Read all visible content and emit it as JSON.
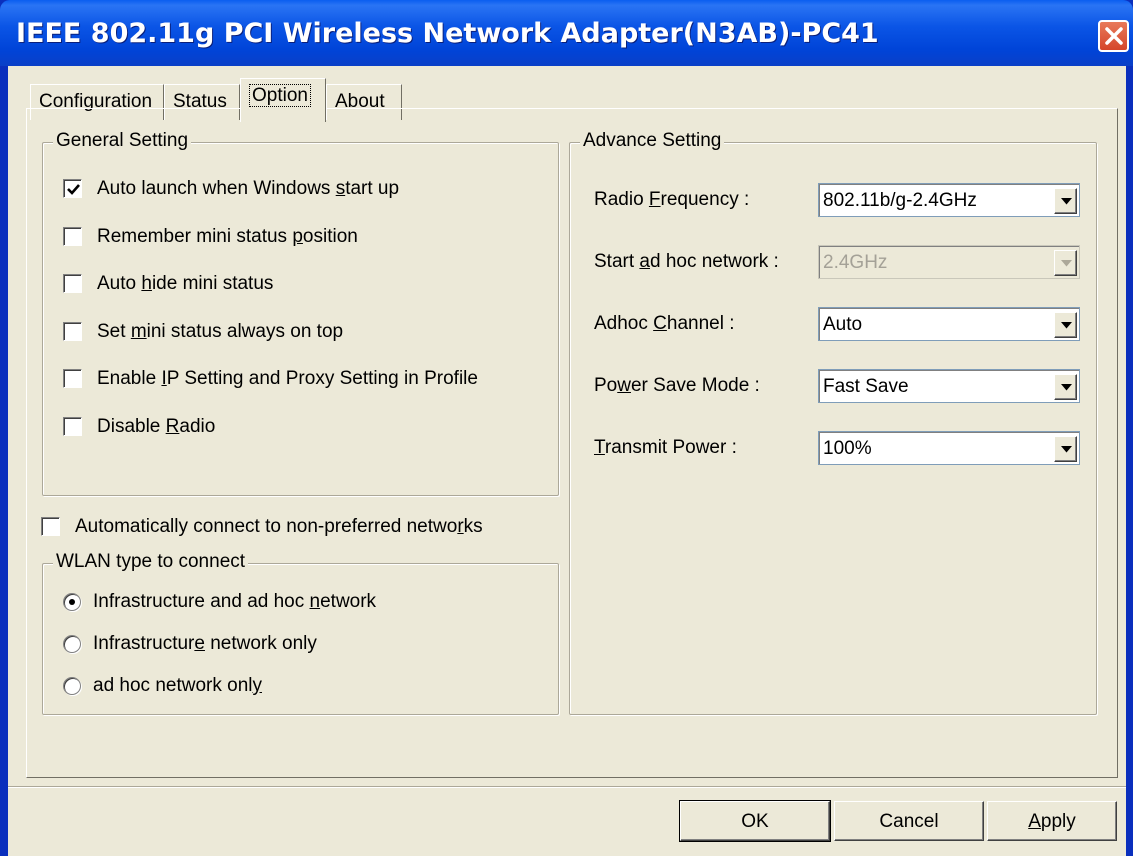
{
  "window": {
    "title": "IEEE 802.11g PCI Wireless Network Adapter(N3AB)-PC41"
  },
  "tabs": [
    {
      "label": "Configuration",
      "active": false
    },
    {
      "label": "Status",
      "active": false
    },
    {
      "label": "Option",
      "active": true
    },
    {
      "label": "About",
      "active": false
    }
  ],
  "general_setting": {
    "title": "General Setting",
    "items": [
      {
        "pre": "Auto launch when Windows ",
        "accel": "s",
        "post": "tart up",
        "checked": true
      },
      {
        "pre": "Remember mini status ",
        "accel": "p",
        "post": "osition",
        "checked": false
      },
      {
        "pre": "Auto ",
        "accel": "h",
        "post": "ide mini status",
        "checked": false
      },
      {
        "pre": "Set ",
        "accel": "m",
        "post": "ini status always on top",
        "checked": false
      },
      {
        "pre": "Enable ",
        "accel": "I",
        "post": "P Setting and Proxy Setting in Profile",
        "checked": false
      },
      {
        "pre": "Disable ",
        "accel": "R",
        "post": "adio",
        "checked": false
      }
    ]
  },
  "auto_connect": {
    "pre": "Automatically connect to non-preferred netwo",
    "accel": "r",
    "post": "ks",
    "checked": false
  },
  "wlan_type": {
    "title": "WLAN type to connect",
    "options": [
      {
        "pre": "Infrastructure and ad hoc ",
        "accel": "n",
        "post": "etwork",
        "selected": true
      },
      {
        "pre": "Infrastructur",
        "accel": "e",
        "post": " network only",
        "selected": false
      },
      {
        "pre": "ad hoc network onl",
        "accel": "y",
        "post": "",
        "selected": false
      }
    ]
  },
  "advance_setting": {
    "title": "Advance Setting",
    "rows": [
      {
        "pre": "Radio ",
        "accel": "F",
        "post": "requency :",
        "value": "802.11b/g-2.4GHz",
        "enabled": true
      },
      {
        "pre": "Start ",
        "accel": "a",
        "post": "d hoc network :",
        "value": "2.4GHz",
        "enabled": false
      },
      {
        "pre": "Adhoc ",
        "accel": "C",
        "post": "hannel :",
        "value": "Auto",
        "enabled": true
      },
      {
        "pre": "Po",
        "accel": "w",
        "post": "er Save Mode :",
        "value": "Fast Save",
        "enabled": true
      },
      {
        "pre": "",
        "accel": "T",
        "post": "ransmit Power :",
        "value": "100%",
        "enabled": true
      }
    ]
  },
  "buttons": {
    "ok": "OK",
    "cancel": "Cancel",
    "apply_accel": "A",
    "apply_rest": "pply"
  },
  "icons": {
    "close": "close-icon",
    "check": "check-icon",
    "dropdown": "chevron-down-icon"
  },
  "colors": {
    "titlebar": "#0054e3",
    "close_button": "#e0593a",
    "dialog_background": "#ece9d8"
  }
}
